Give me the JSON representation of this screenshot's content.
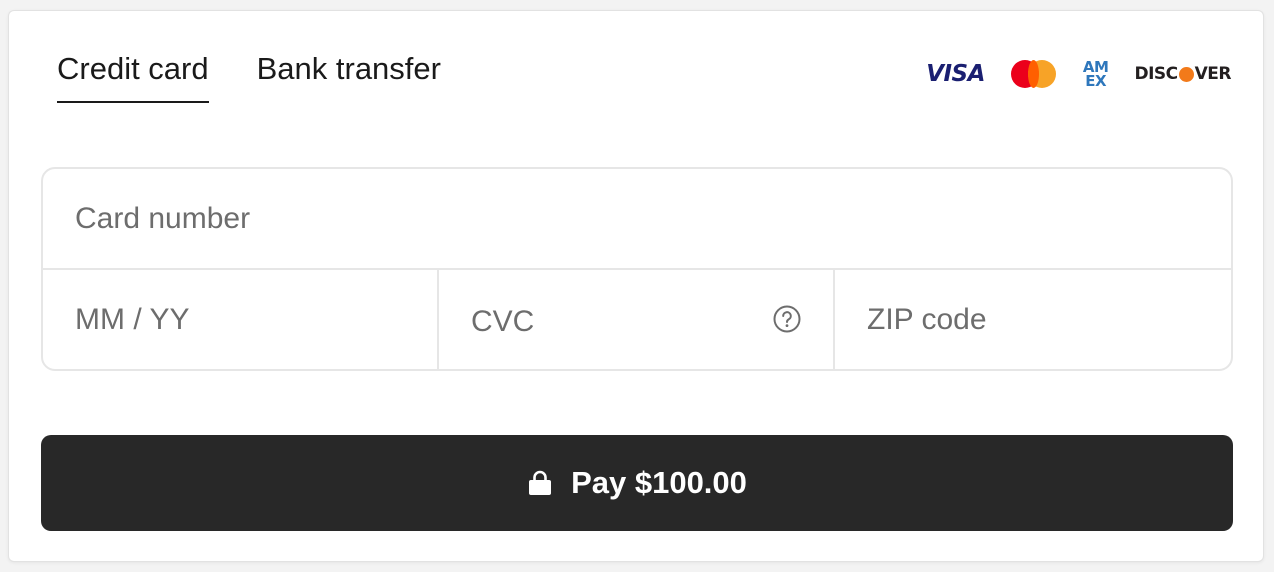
{
  "tabs": [
    {
      "label": "Credit card",
      "active": true
    },
    {
      "label": "Bank transfer",
      "active": false
    }
  ],
  "brands": {
    "visa": "VISA",
    "mastercard_icon": "mastercard-logo",
    "amex_top": "AM",
    "amex_bottom": "EX",
    "discover_left": "DISC",
    "discover_right": "VER"
  },
  "form": {
    "card_number_placeholder": "Card number",
    "expiry_placeholder": "MM / YY",
    "cvc_placeholder": "CVC",
    "cvc_help_icon": "question-circle-icon",
    "zip_placeholder": "ZIP code"
  },
  "pay_button": {
    "icon": "lock-icon",
    "label": "Pay $100.00"
  },
  "colors": {
    "button_bg": "#282828",
    "visa": "#1a1f71",
    "amex": "#2e77bc",
    "discover_dot": "#f27a1a",
    "mastercard_red": "#eb001b",
    "mastercard_yellow": "#f79e1b"
  }
}
